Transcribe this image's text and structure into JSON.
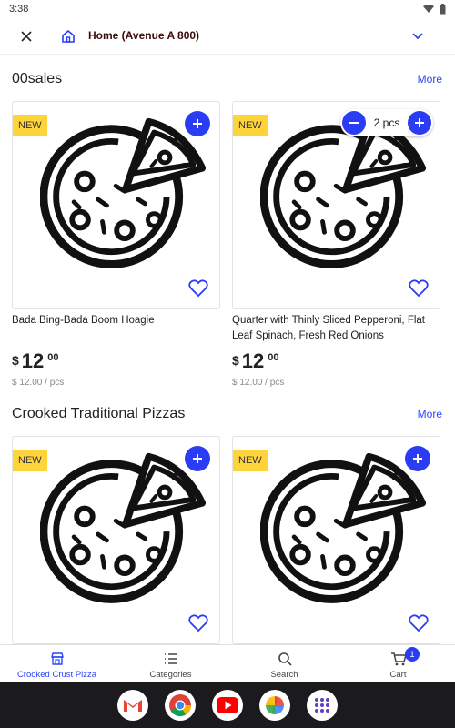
{
  "status_bar": {
    "time": "3:38"
  },
  "header": {
    "address": "Home (Avenue A 800)"
  },
  "sections": [
    {
      "title": "00sales",
      "more": "More",
      "products": [
        {
          "badge": "NEW",
          "name": "Bada Bing-Bada Boom Hoagie",
          "currency": "$",
          "price_whole": "12",
          "price_cents": "00",
          "unit_price": "$ 12.00 / pcs"
        },
        {
          "badge": "NEW",
          "name": "Quarter with Thinly Sliced Pepperoni, Flat Leaf Spinach, Fresh Red Onions",
          "currency": "$",
          "price_whole": "12",
          "price_cents": "00",
          "unit_price": "$ 12.00 / pcs",
          "quantity": "2 pcs"
        }
      ]
    },
    {
      "title": "Crooked Traditional Pizzas",
      "more": "More",
      "products": [
        {
          "badge": "NEW"
        },
        {
          "badge": "NEW"
        }
      ]
    }
  ],
  "bottom_nav": {
    "items": [
      {
        "label": "Crooked Crust Pizza",
        "icon": "store-icon"
      },
      {
        "label": "Categories",
        "icon": "list-icon"
      },
      {
        "label": "Search",
        "icon": "search-icon"
      },
      {
        "label": "Cart",
        "icon": "cart-icon",
        "badge": "1"
      }
    ]
  },
  "dock": {
    "apps": [
      "gmail-icon",
      "chrome-icon",
      "youtube-icon",
      "photos-icon",
      "app-drawer-icon"
    ]
  },
  "colors": {
    "accent": "#2b3cf5",
    "badge_yellow": "#ffd43b",
    "link": "#2b46ff"
  }
}
